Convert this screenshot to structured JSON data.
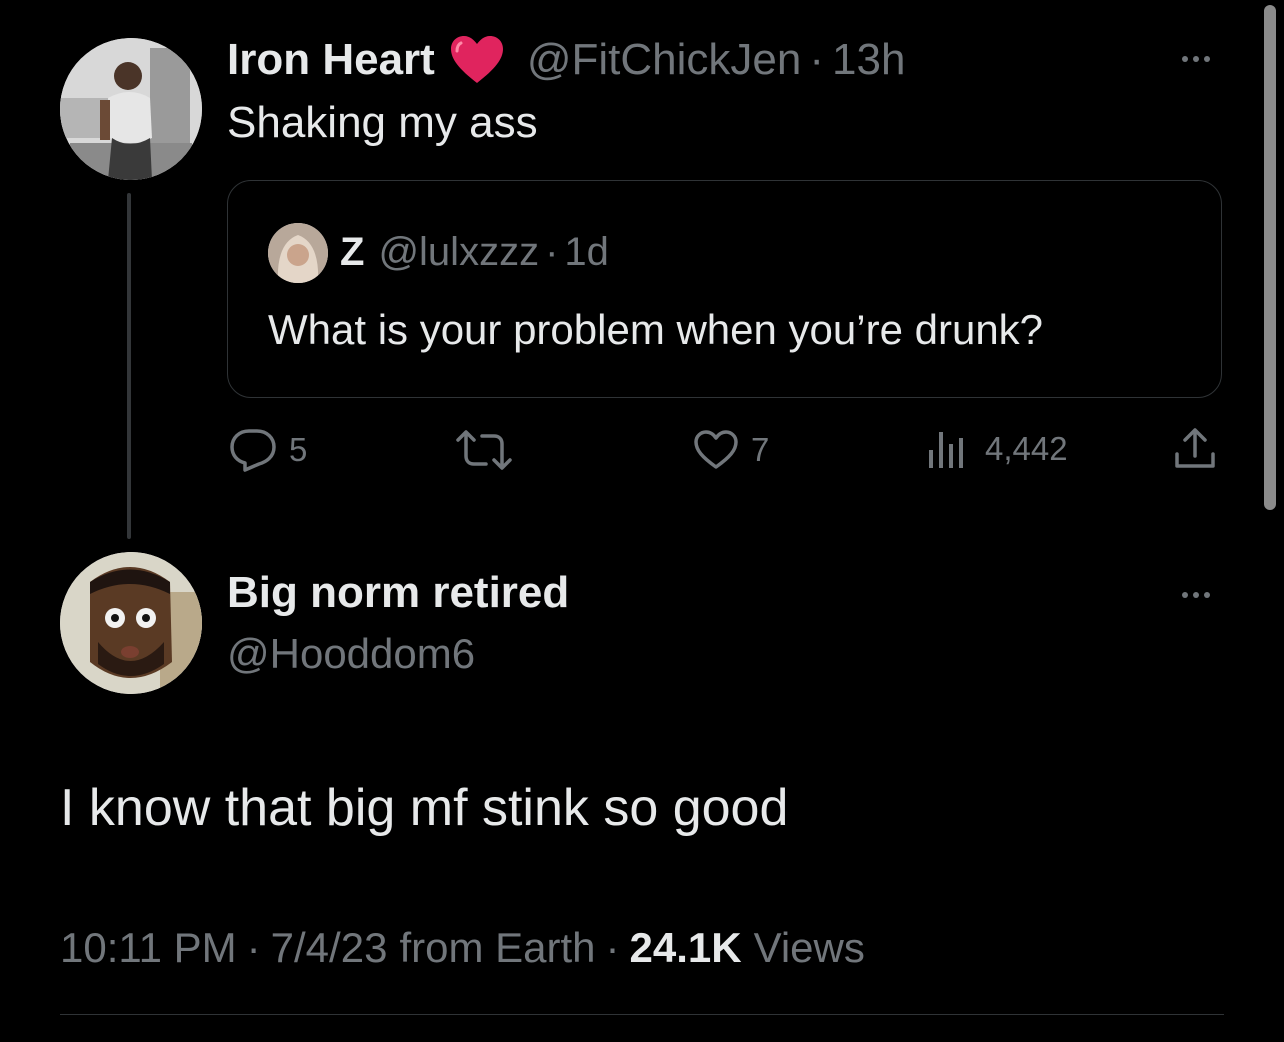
{
  "original_tweet": {
    "display_name": "Iron Heart",
    "handle": "@FitChickJen",
    "separator": "·",
    "time": "13h",
    "text": "Shaking my ass",
    "name_emoji": "❤️"
  },
  "quoted_tweet": {
    "display_name": "Z",
    "handle": "@lulxzzz",
    "separator": "·",
    "time": "1d",
    "text": "What is your problem when you’re drunk?"
  },
  "actions": {
    "reply_count": "5",
    "retweet_count": "",
    "like_count": "7",
    "view_count": "4,442"
  },
  "reply_tweet": {
    "display_name": "Big norm retired",
    "handle": "@Hooddom6",
    "text": "I know that big mf stink so good",
    "meta_time": "10:11 PM",
    "meta_sep1": "·",
    "meta_date": "7/4/23",
    "meta_source": "from Earth",
    "meta_sep2": "·",
    "views_count": "24.1K",
    "views_label": "Views"
  },
  "colors": {
    "background": "#000000",
    "text_primary": "#e7e9ea",
    "text_muted": "#71767b",
    "heart_red": "#e0245e"
  }
}
